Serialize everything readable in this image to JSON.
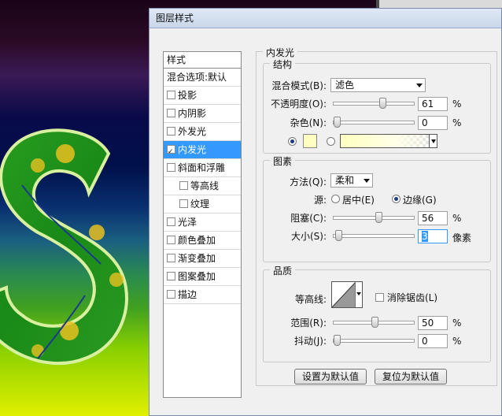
{
  "dialog": {
    "title": "图层样式"
  },
  "styles": {
    "header": "样式",
    "blend_default": "混合选项:默认",
    "items": [
      {
        "label": "投影",
        "checked": false,
        "selected": false,
        "sub": false
      },
      {
        "label": "内阴影",
        "checked": false,
        "selected": false,
        "sub": false
      },
      {
        "label": "外发光",
        "checked": false,
        "selected": false,
        "sub": false
      },
      {
        "label": "内发光",
        "checked": true,
        "selected": true,
        "sub": false
      },
      {
        "label": "斜面和浮雕",
        "checked": false,
        "selected": false,
        "sub": false
      },
      {
        "label": "等高线",
        "checked": false,
        "selected": false,
        "sub": true
      },
      {
        "label": "纹理",
        "checked": false,
        "selected": false,
        "sub": true
      },
      {
        "label": "光泽",
        "checked": false,
        "selected": false,
        "sub": false
      },
      {
        "label": "颜色叠加",
        "checked": false,
        "selected": false,
        "sub": false
      },
      {
        "label": "渐变叠加",
        "checked": false,
        "selected": false,
        "sub": false
      },
      {
        "label": "图案叠加",
        "checked": false,
        "selected": false,
        "sub": false
      },
      {
        "label": "描边",
        "checked": false,
        "selected": false,
        "sub": false
      }
    ]
  },
  "inner_glow": {
    "title": "内发光",
    "structure": {
      "title": "结构",
      "blend_mode_label": "混合模式(B):",
      "blend_mode_value": "滤色",
      "opacity_label": "不透明度(O):",
      "opacity_value": "61",
      "opacity_level": 0.61,
      "noise_label": "杂色(N):",
      "noise_value": "0",
      "noise_level": 0,
      "percent": "%",
      "glow_color": "#ffffc0"
    },
    "elements": {
      "title": "图素",
      "technique_label": "方法(Q):",
      "technique_value": "柔和",
      "source_label": "源:",
      "source_center": "居中(E)",
      "source_edge": "边缘(G)",
      "choke_label": "阻塞(C):",
      "choke_value": "56",
      "choke_level": 0.56,
      "size_label": "大小(S):",
      "size_value": "3",
      "size_unit": "像素",
      "percent": "%"
    },
    "quality": {
      "title": "品质",
      "contour_label": "等高线:",
      "anti_alias_label": "消除锯齿(L)",
      "range_label": "范围(R):",
      "range_value": "50",
      "range_level": 0.5,
      "jitter_label": "抖动(J):",
      "jitter_value": "0",
      "jitter_level": 0,
      "percent": "%"
    },
    "buttons": {
      "make_default": "设置为默认值",
      "reset_default": "复位为默认值"
    }
  }
}
